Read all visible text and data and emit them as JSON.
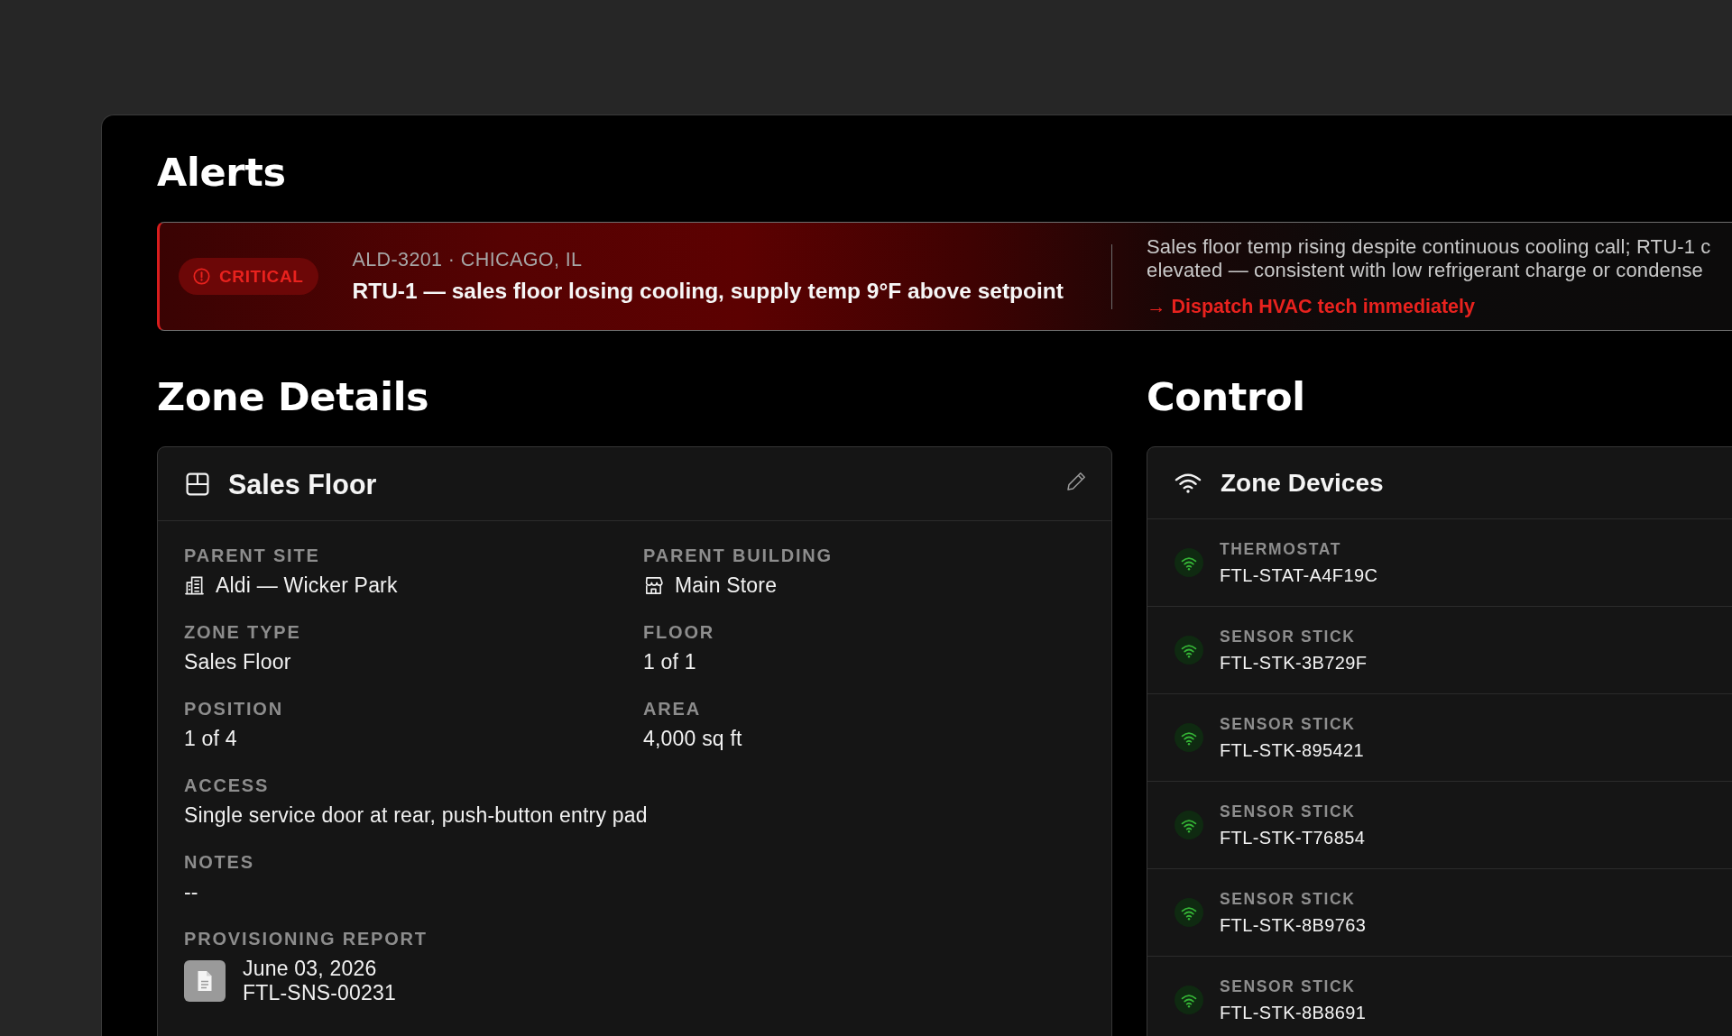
{
  "alerts": {
    "title": "Alerts",
    "items": [
      {
        "kind": "critical",
        "severity_label": "CRITICAL",
        "meta": "ALD-3201 · CHICAGO, IL",
        "headline": "RTU-1 — sales floor losing cooling, supply temp 9°F above setpoint",
        "description_lines": [
          "Sales floor temp rising despite continuous cooling call; RTU-1 c",
          "elevated — consistent with low refrigerant charge or condense"
        ],
        "action": "→ Dispatch HVAC tech immediately"
      }
    ]
  },
  "zone_details": {
    "title": "Zone Details",
    "card": {
      "name": "Sales Floor",
      "rows": [
        [
          {
            "kind": "site",
            "label": "PARENT SITE",
            "value": "Aldi — Wicker Park"
          },
          {
            "kind": "building",
            "label": "PARENT BUILDING",
            "value": "Main Store"
          }
        ],
        [
          {
            "kind": "text",
            "label": "ZONE TYPE",
            "value": "Sales Floor"
          },
          {
            "kind": "text",
            "label": "FLOOR",
            "value": "1 of 1"
          }
        ],
        [
          {
            "kind": "text",
            "label": "POSITION",
            "value": "1 of 4"
          },
          {
            "kind": "text",
            "label": "AREA",
            "value": "4,000 sq ft"
          }
        ],
        [
          {
            "kind": "text",
            "label": "ACCESS",
            "value": "Single service door at rear, push-button entry pad"
          }
        ],
        [
          {
            "kind": "text",
            "label": "NOTES",
            "value": "--"
          }
        ],
        [
          {
            "kind": "report",
            "label": "PROVISIONING REPORT",
            "date": "June 03, 2026",
            "id": "FTL-SNS-00231"
          }
        ]
      ]
    }
  },
  "control": {
    "title": "Control",
    "card": {
      "title": "Zone Devices",
      "devices": [
        {
          "type": "THERMOSTAT",
          "id": "FTL-STAT-A4F19C",
          "online": true
        },
        {
          "type": "SENSOR STICK",
          "id": "FTL-STK-3B729F",
          "online": true
        },
        {
          "type": "SENSOR STICK",
          "id": "FTL-STK-895421",
          "online": true
        },
        {
          "type": "SENSOR STICK",
          "id": "FTL-STK-T76854",
          "online": true
        },
        {
          "type": "SENSOR STICK",
          "id": "FTL-STK-8B9763",
          "online": true
        },
        {
          "type": "SENSOR STICK",
          "id": "FTL-STK-8B8691",
          "online": true
        }
      ]
    }
  }
}
